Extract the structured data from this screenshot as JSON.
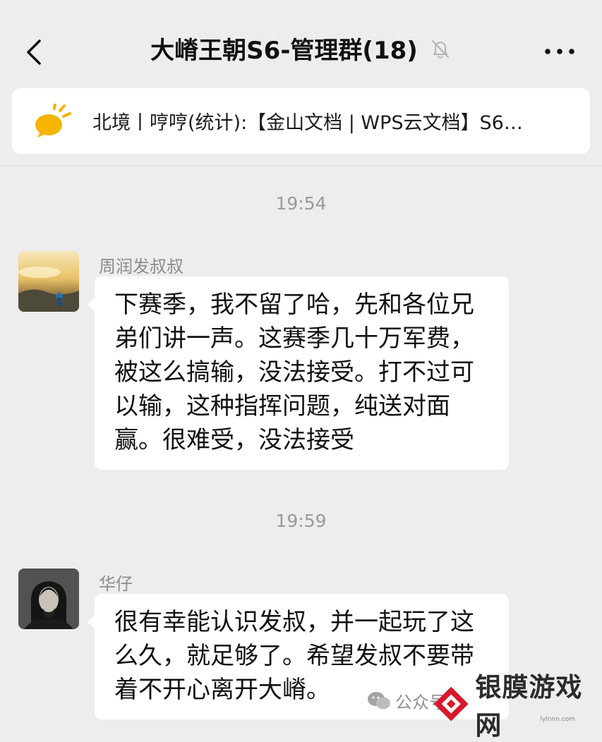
{
  "header": {
    "title": "大嵴王朝S6-管理群(18)",
    "back_icon": "chevron-left-icon",
    "mute_icon": "bell-off-icon",
    "more_icon": "more-dots-icon"
  },
  "announcement": {
    "icon": "megaphone-icon",
    "text": "北境丨哼哼(统计):【金山文档 | WPS云文档】S6…"
  },
  "messages": [
    {
      "timestamp": "19:54",
      "sender": "周润发叔叔",
      "lines": [
        "下赛季，我不留了哈，先和各位兄",
        "弟们讲一声。这赛季几十万军费，",
        "被这么搞输，没法接受。打不过可",
        "以输，这种指挥问题，纯送对面",
        "赢。很难受，没法接受"
      ]
    },
    {
      "timestamp": "19:59",
      "sender": "华仔",
      "lines": [
        "很有幸能认识发叔，并一起玩了这",
        "么久，就足够了。希望发叔不要带",
        "着不开心离开大嵴。"
      ]
    }
  ],
  "watermark": {
    "official_account": "公众号",
    "site_name": "银膜游戏网",
    "site_domain": "lylnnn.com"
  },
  "colors": {
    "background": "#ededed",
    "bubble": "#ffffff",
    "announce_icon": "#f5b400"
  }
}
